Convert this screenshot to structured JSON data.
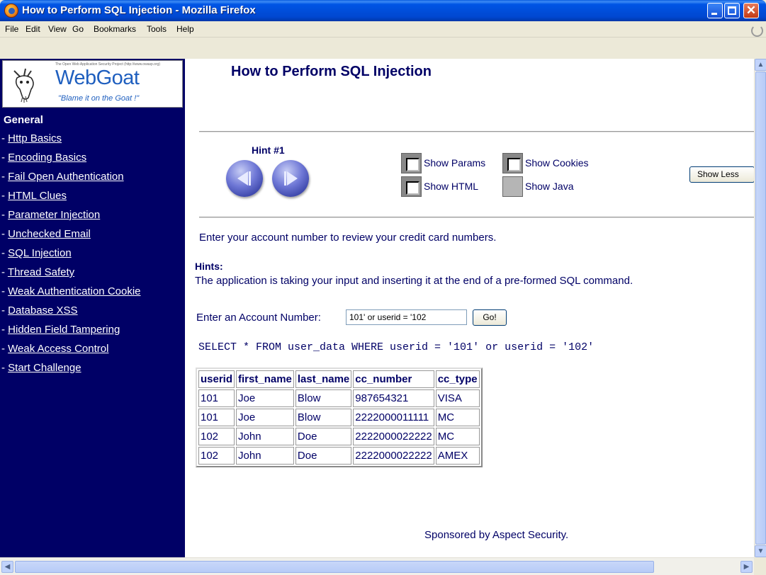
{
  "window": {
    "title": "How to Perform SQL Injection - Mozilla Firefox"
  },
  "menu": [
    {
      "label": "File",
      "accel": "F"
    },
    {
      "label": "Edit",
      "accel": "E"
    },
    {
      "label": "View",
      "accel": "V"
    },
    {
      "label": "Go",
      "accel": "G"
    },
    {
      "label": "Bookmarks",
      "accel": "B"
    },
    {
      "label": "Tools",
      "accel": "T"
    },
    {
      "label": "Help",
      "accel": "H"
    }
  ],
  "logo": {
    "tagline": "The Open Web Application Security Project (http://www.owasp.org)",
    "brand": "WebGoat",
    "slogan": "\"Blame it on the Goat !\""
  },
  "sidebar": {
    "heading": "General",
    "items": [
      {
        "label": "Http Basics"
      },
      {
        "label": "Encoding Basics"
      },
      {
        "label": "Fail Open Authentication"
      },
      {
        "label": "HTML Clues"
      },
      {
        "label": "Parameter Injection"
      },
      {
        "label": "Unchecked Email"
      },
      {
        "label": "SQL Injection"
      },
      {
        "label": "Thread Safety"
      },
      {
        "label": "Weak Authentication Cookie"
      },
      {
        "label": "Database XSS"
      },
      {
        "label": "Hidden Field Tampering"
      },
      {
        "label": "Weak Access Control"
      },
      {
        "label": "Start Challenge"
      }
    ]
  },
  "page": {
    "title": "How to Perform SQL Injection",
    "hint_label": "Hint #1",
    "options": {
      "show_params": "Show Params",
      "show_cookies": "Show Cookies",
      "show_html": "Show HTML",
      "show_java": "Show Java"
    },
    "show_less": "Show Less",
    "intro": "Enter your account number to review your credit card numbers.",
    "hints_heading": "Hints:",
    "hints_text": "The application is taking your input and inserting it at the end of a pre-formed SQL command.",
    "account_label": "Enter an Account Number:",
    "account_value": "101' or userid = '102",
    "go_label": "Go!",
    "sql": "SELECT * FROM user_data WHERE userid = '101' or userid = '102'",
    "sponsor": "Sponsored by Aspect Security."
  },
  "table": {
    "columns": [
      "userid",
      "first_name",
      "last_name",
      "cc_number",
      "cc_type"
    ],
    "rows": [
      [
        "101",
        "Joe",
        "Blow",
        "987654321",
        "VISA"
      ],
      [
        "101",
        "Joe",
        "Blow",
        "2222000011111",
        "MC"
      ],
      [
        "102",
        "John",
        "Doe",
        "2222000022222",
        "MC"
      ],
      [
        "102",
        "John",
        "Doe",
        "2222000022222",
        "AMEX"
      ]
    ]
  },
  "colors": {
    "sidebar": "#000066",
    "text": "#000066",
    "titlebar": "#0055e5"
  }
}
